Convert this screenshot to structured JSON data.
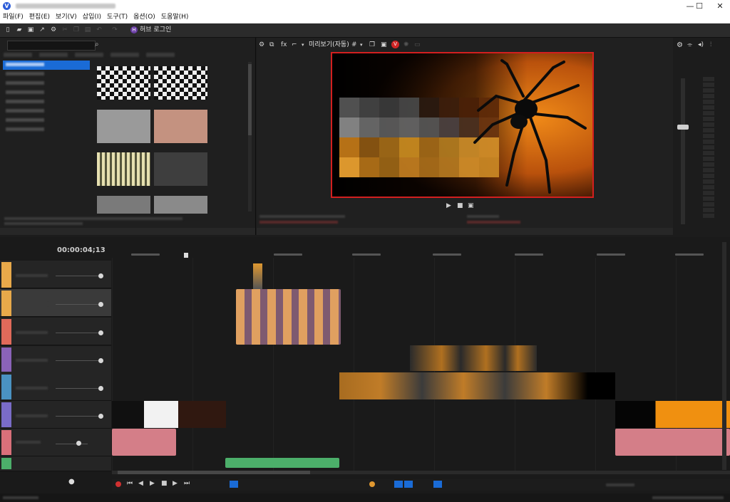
{
  "app": {
    "logo_letter": "V",
    "window_buttons": [
      "—",
      "☐",
      "✕"
    ]
  },
  "menu": {
    "items": [
      "파일(F)",
      "편집(E)",
      "보기(V)",
      "삽입(I)",
      "도구(T)",
      "옵션(O)",
      "도움말(H)"
    ]
  },
  "toolbar": {
    "icons": [
      "new-file-icon",
      "open-folder-icon",
      "save-icon",
      "export-icon",
      "settings-icon",
      "cut-icon",
      "copy-icon",
      "paste-icon",
      "undo-icon",
      "redo-icon"
    ],
    "hub_badge": "H",
    "hub_label": "허브 로그인"
  },
  "preview": {
    "mode_label": "미리보기(자동)",
    "fx_label": "fx",
    "rec_badge": "V"
  },
  "timeline": {
    "current_time": "00:00:04;13"
  },
  "colors": {
    "accent_blue": "#1a6bd6",
    "preview_border": "#d31f1f",
    "track_colors": [
      "#e8a94a",
      "#e8a94a",
      "#e06a5a",
      "#8a63b8",
      "#4a92c2",
      "#7a6cc8",
      "#d9707a",
      "#4caf6a"
    ]
  }
}
